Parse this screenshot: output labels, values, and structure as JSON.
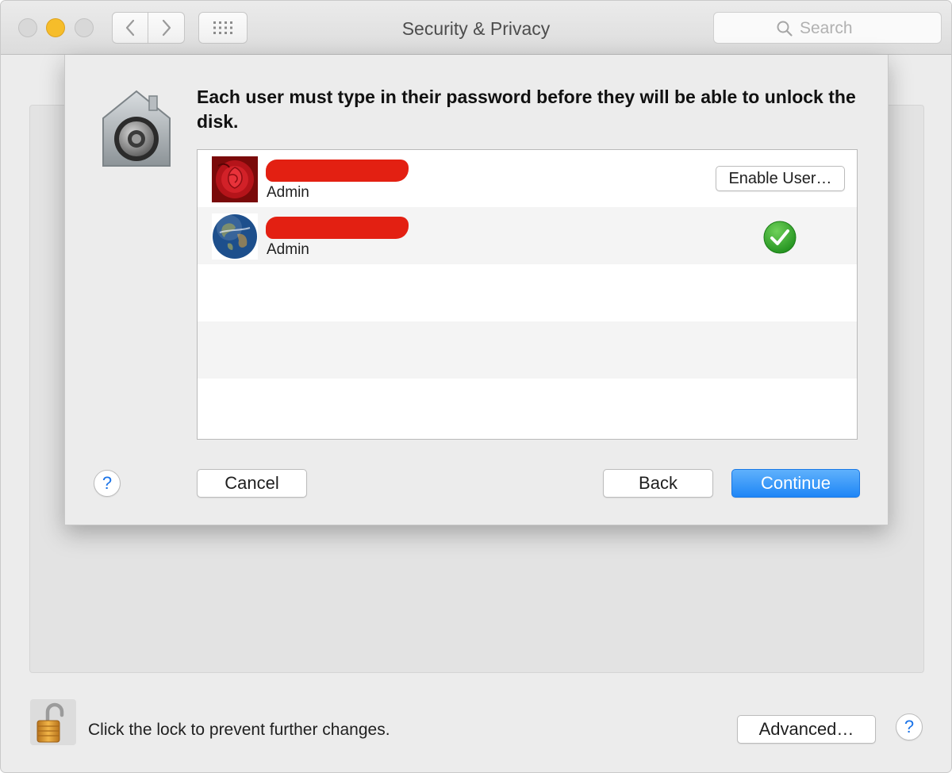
{
  "window": {
    "title": "Security & Privacy"
  },
  "toolbar": {
    "back_icon": "chevron-left-icon",
    "forward_icon": "chevron-right-icon",
    "show_all_icon": "grid-icon"
  },
  "search": {
    "placeholder": "Search",
    "icon": "search-icon"
  },
  "sheet": {
    "icon": "filevault-vault-icon",
    "message": "Each user must type in their password before they will be able to unlock the disk.",
    "users": [
      {
        "avatar": "rose-avatar",
        "name_redacted": true,
        "role": "Admin",
        "action_label": "Enable User…",
        "enabled": false
      },
      {
        "avatar": "earth-avatar",
        "name_redacted": true,
        "role": "Admin",
        "enabled": true,
        "status_icon": "green-checkmark-icon"
      }
    ],
    "help_label": "?",
    "cancel_label": "Cancel",
    "back_label": "Back",
    "continue_label": "Continue"
  },
  "footer": {
    "lock_icon": "unlocked-padlock-icon",
    "lock_text": "Click the lock to prevent further changes.",
    "advanced_label": "Advanced…",
    "help_label": "?"
  },
  "colors": {
    "accent": "#1f86f6",
    "traffic_minimize": "#f6bd2a",
    "redaction": "#e32012",
    "check_green": "#2fa82c"
  }
}
